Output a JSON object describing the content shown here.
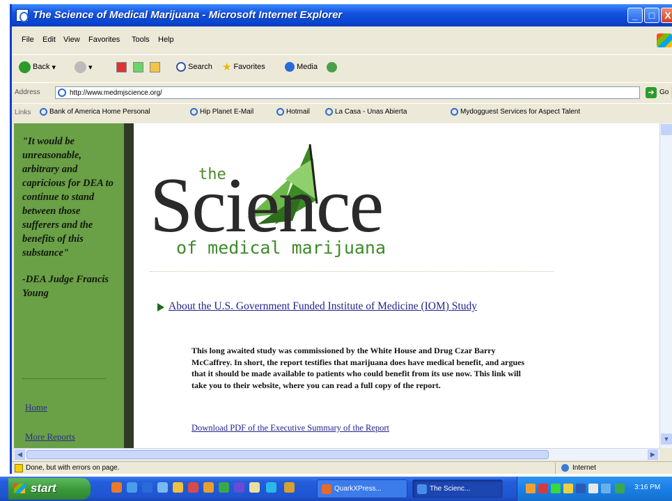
{
  "window": {
    "title": "The Science of Medical Marijuana - Microsoft Internet Explorer",
    "min": "_",
    "max": "□",
    "close": "X"
  },
  "menu": [
    "File",
    "Edit",
    "View",
    "Favorites",
    "Tools",
    "Help"
  ],
  "toolbar": {
    "back": "Back",
    "search": "Search",
    "favorites": "Favorites",
    "media": "Media"
  },
  "address": {
    "label": "Address",
    "url": "http://www.medmjscience.org/",
    "go": "Go"
  },
  "links": {
    "label": "Links",
    "items": [
      "Bank of America Home Personal",
      "Hip Planet E-Mail",
      "Hotmail",
      "La Casa - Unas Abierta",
      "Mydogguest Services for Aspect Talent"
    ]
  },
  "sidebar": {
    "quote": "\"It would be unreasonable, arbitrary and capricious for DEA to continue to stand between those sufferers and the benefits of this substance\"",
    "attribution": "-DEA Judge Francis Young",
    "link1": "Home",
    "link2": "More Reports"
  },
  "logo": {
    "word": "Science",
    "small": "the",
    "tagline": "of medical marijuana"
  },
  "main": {
    "link": "About the U.S. Government Funded Institute of Medicine (IOM) Study",
    "body": "This long awaited study was commissioned by the White House and Drug Czar Barry McCaffrey. In short, the report testifies that marijuana does have medical benefit, and argues that it should be made available to patients who could benefit from its use now. This link will take you to their website, where you can read a full copy of the report.",
    "pdf_link": "Download PDF of the Executive Summary of the Report"
  },
  "status": {
    "message": "Done, but with errors on page.",
    "zone": "Internet"
  },
  "taskbar": {
    "start": "start",
    "tasks": [
      "QuarkXPress...",
      "The Scienc..."
    ],
    "clock": "3:16 PM"
  },
  "colors": {
    "sidebar": "#6aa046",
    "link": "#23238c",
    "titlebar": "#0b45d0"
  }
}
